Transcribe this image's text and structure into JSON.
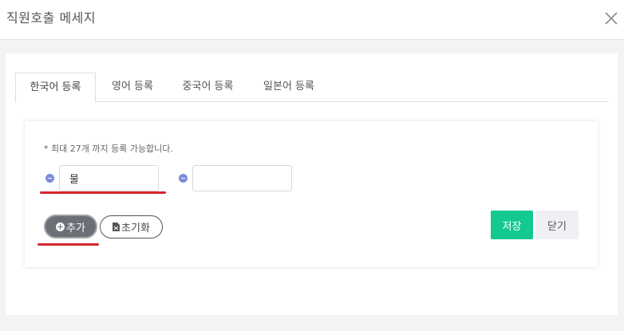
{
  "dialog": {
    "title": "직원호출 메세지",
    "close_icon": "close-icon"
  },
  "tabs": [
    {
      "label": "한국어 등록",
      "active": true
    },
    {
      "label": "영어 등록",
      "active": false
    },
    {
      "label": "중국어 등록",
      "active": false
    },
    {
      "label": "일본어 등록",
      "active": false
    }
  ],
  "form": {
    "notice": "* 최대 27개 까지 등록 가능합니다.",
    "entries": [
      {
        "value": "물",
        "placeholder": ""
      },
      {
        "value": "",
        "placeholder": ""
      }
    ],
    "remove_icon": "minus-circle-icon"
  },
  "actions": {
    "add_label": "추가",
    "add_icon": "plus-circle-icon",
    "reset_label": "초기화",
    "reset_icon": "file-icon",
    "save_label": "저장",
    "close_label": "닫기"
  },
  "colors": {
    "save": "#14c98f",
    "highlight": "#d6262e",
    "remove_icon": "#7b8bdc"
  }
}
